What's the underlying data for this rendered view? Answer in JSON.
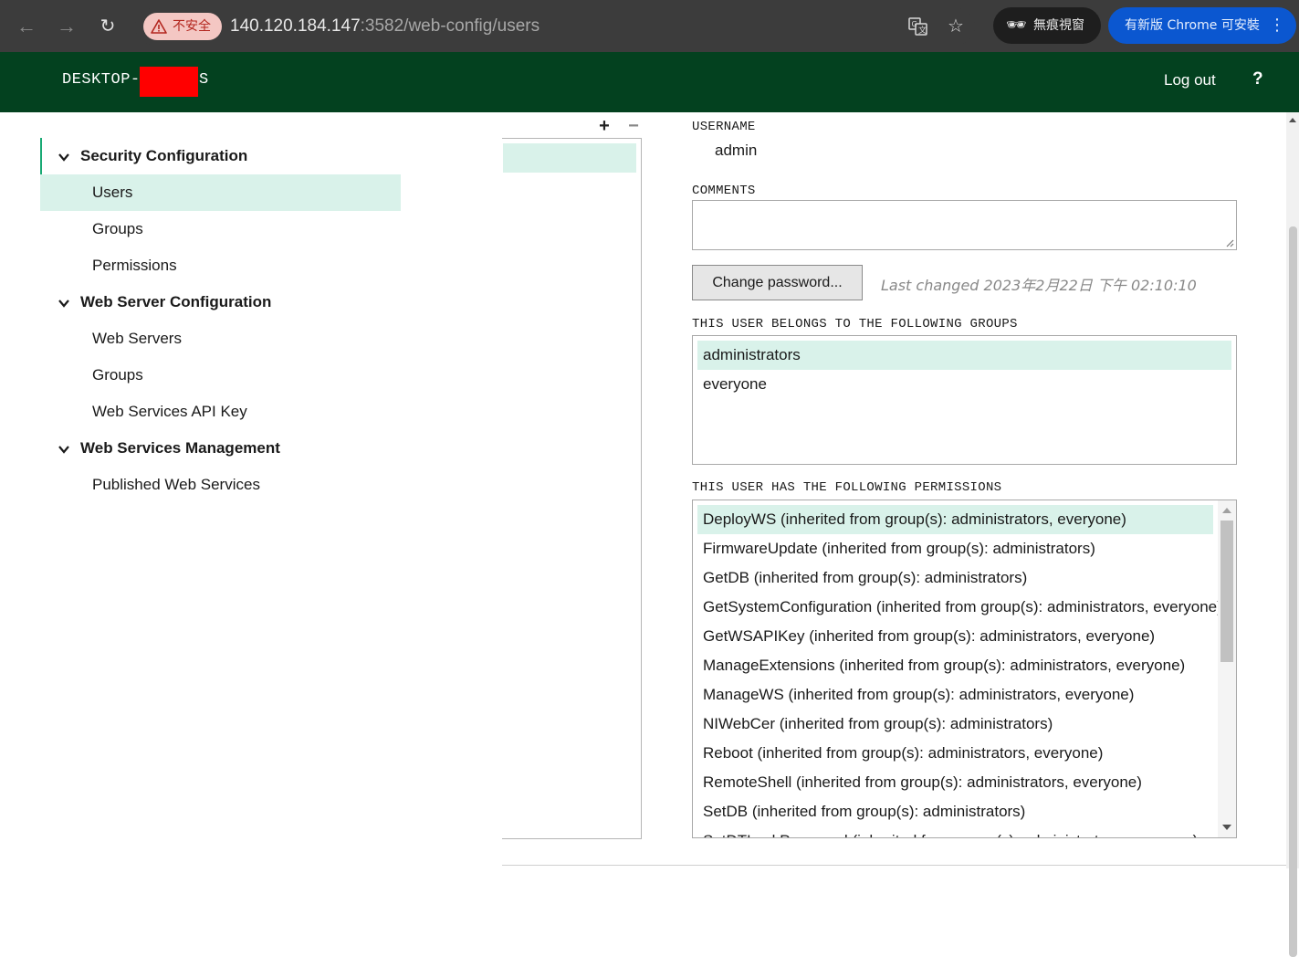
{
  "browser": {
    "insecure_label": "不安全",
    "url_host": "140.120.184.147",
    "url_rest": ":3582/web-config/users",
    "incognito_label": "無痕視窗",
    "update_label": "有新版 Chrome 可安裝"
  },
  "header": {
    "host_prefix": "DESKTOP-",
    "host_suffix": "S",
    "logout_label": "Log out",
    "help_label": "?",
    "bg_color": "#03411f"
  },
  "tree": {
    "sections": [
      {
        "title": "Security Configuration",
        "items": [
          "Users",
          "Groups",
          "Permissions"
        ]
      },
      {
        "title": "Web Server Configuration",
        "items": [
          "Web Servers",
          "Groups",
          "Web Services API Key"
        ]
      },
      {
        "title": "Web Services Management",
        "items": [
          "Published Web Services"
        ]
      }
    ],
    "selected_color": "#d9f2ea",
    "accent_color": "#19a974"
  },
  "list_tools": {
    "add": "+",
    "remove": "−"
  },
  "detail": {
    "username_label": "USERNAME",
    "username_value": "admin",
    "comments_label": "COMMENTS",
    "comments_value": "",
    "change_password_label": "Change password...",
    "last_changed": "Last changed 2023年2月22日 下午 02:10:10",
    "groups_label": "THIS USER BELONGS TO THE FOLLOWING GROUPS",
    "groups": [
      "administrators",
      "everyone"
    ],
    "permissions_label": "THIS USER HAS THE FOLLOWING PERMISSIONS",
    "permissions": [
      "DeployWS (inherited from group(s): administrators, everyone)",
      "FirmwareUpdate (inherited from group(s): administrators)",
      "GetDB (inherited from group(s): administrators)",
      "GetSystemConfiguration (inherited from group(s): administrators, everyone)",
      "GetWSAPIKey (inherited from group(s): administrators, everyone)",
      "ManageExtensions (inherited from group(s): administrators, everyone)",
      "ManageWS (inherited from group(s): administrators, everyone)",
      "NIWebCer (inherited from group(s): administrators)",
      "Reboot (inherited from group(s): administrators, everyone)",
      "RemoteShell (inherited from group(s): administrators, everyone)",
      "SetDB (inherited from group(s): administrators)",
      "SetDTLockPassword (inherited from group(s): administrators, everyone)"
    ]
  }
}
